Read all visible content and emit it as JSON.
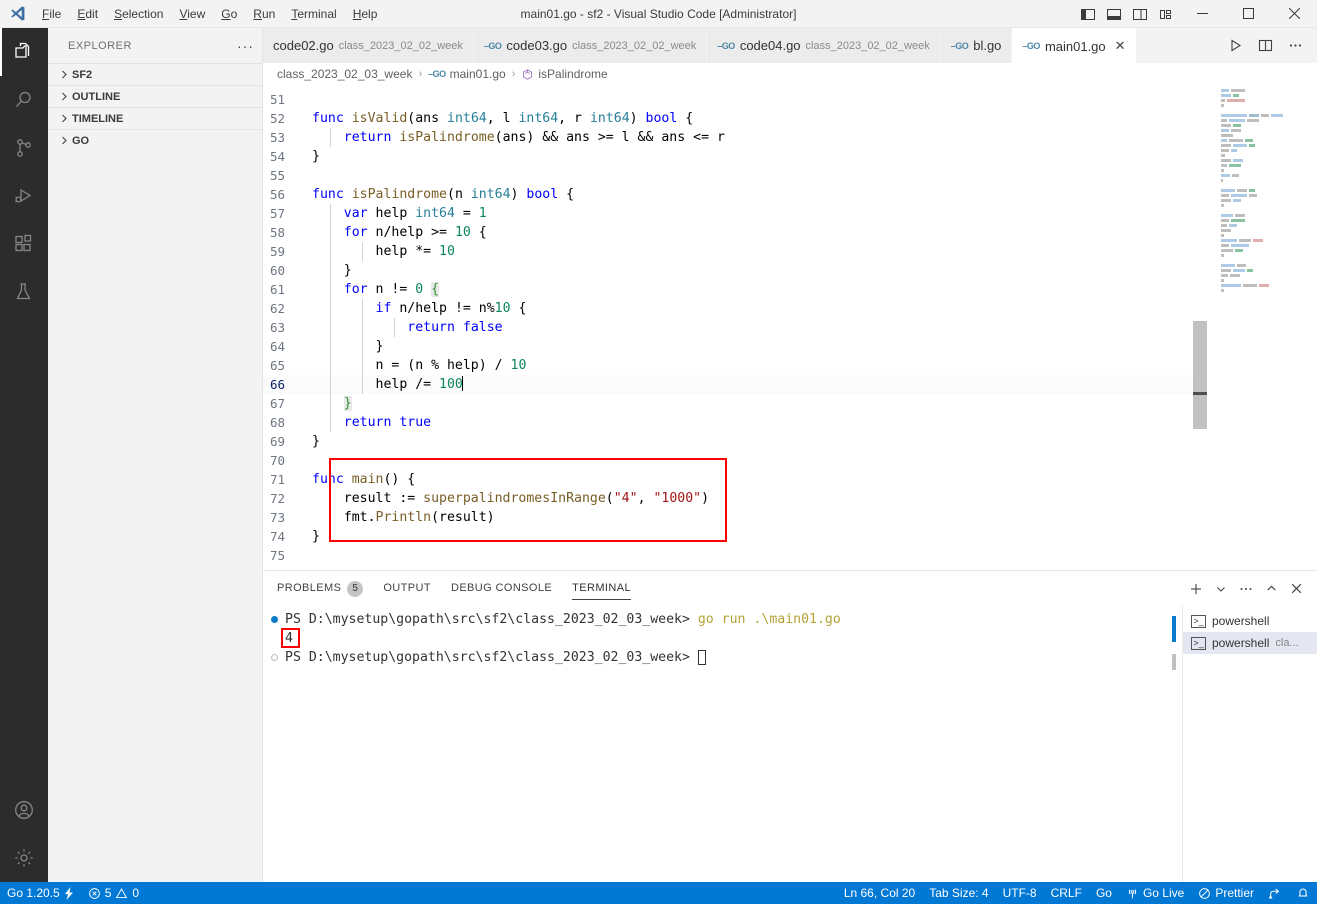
{
  "window": {
    "title": "main01.go - sf2 - Visual Studio Code [Administrator]",
    "logo": "vscode-logo",
    "layout_buttons": [
      {
        "name": "toggle-primary-sidebar",
        "label": "▯"
      },
      {
        "name": "toggle-panel",
        "label": "▯"
      },
      {
        "name": "toggle-secondary-sidebar",
        "label": "▯"
      },
      {
        "name": "customize-layout",
        "label": "▯"
      }
    ],
    "controls": {
      "minimize": "—",
      "maximize": "☐",
      "close": "✕"
    }
  },
  "menubar": [
    {
      "label": "File",
      "accel": "F"
    },
    {
      "label": "Edit",
      "accel": "E"
    },
    {
      "label": "Selection",
      "accel": "S"
    },
    {
      "label": "View",
      "accel": "V"
    },
    {
      "label": "Go",
      "accel": "G"
    },
    {
      "label": "Run",
      "accel": "R"
    },
    {
      "label": "Terminal",
      "accel": "T"
    },
    {
      "label": "Help",
      "accel": "H"
    }
  ],
  "activitybar": [
    {
      "name": "explorer",
      "icon": "files-icon",
      "active": true
    },
    {
      "name": "search",
      "icon": "search-icon",
      "active": false
    },
    {
      "name": "source-control",
      "icon": "source-control-icon",
      "active": false
    },
    {
      "name": "run-and-debug",
      "icon": "run-debug-icon",
      "active": false
    },
    {
      "name": "extensions",
      "icon": "extensions-icon",
      "active": false
    },
    {
      "name": "testing",
      "icon": "beaker-icon",
      "active": false
    },
    {
      "name": "accounts",
      "icon": "account-icon",
      "active": false
    },
    {
      "name": "settings",
      "icon": "gear-icon",
      "active": false
    }
  ],
  "sidebar": {
    "title": "EXPLORER",
    "more_actions": "···",
    "sections": [
      {
        "label": "SF2",
        "expanded": false
      },
      {
        "label": "OUTLINE",
        "expanded": false
      },
      {
        "label": "TIMELINE",
        "expanded": false
      },
      {
        "label": "GO",
        "expanded": false
      }
    ]
  },
  "tabs": [
    {
      "name": "code02.go",
      "description": "class_2023_02_02_week",
      "active": false,
      "has_go_icon": false,
      "dirty": false
    },
    {
      "name": "code03.go",
      "description": "class_2023_02_02_week",
      "active": false,
      "has_go_icon": true,
      "dirty": false
    },
    {
      "name": "code04.go",
      "description": "class_2023_02_02_week",
      "active": false,
      "has_go_icon": true,
      "dirty": false
    },
    {
      "name": "bl.go",
      "description": "",
      "active": false,
      "has_go_icon": true,
      "dirty": false
    },
    {
      "name": "main01.go",
      "description": "",
      "active": true,
      "has_go_icon": true,
      "dirty": false
    }
  ],
  "tab_actions": [
    {
      "name": "run-code-button",
      "icon": "play-icon"
    },
    {
      "name": "split-editor-button",
      "icon": "split-icon"
    },
    {
      "name": "more-actions-button",
      "icon": "ellipsis-icon"
    }
  ],
  "breadcrumbs": [
    {
      "label": "class_2023_02_03_week",
      "icon": ""
    },
    {
      "label": "main01.go",
      "icon": "go-file-icon"
    },
    {
      "label": "isPalindrome",
      "icon": "symbol-method-icon"
    }
  ],
  "editor": {
    "first_line": 51,
    "cursor_line": 66,
    "lines": [
      {
        "n": 51,
        "text": ""
      },
      {
        "n": 52,
        "text": "func isValid(ans int64, l int64, r int64) bool {"
      },
      {
        "n": 53,
        "text": "    return isPalindrome(ans) && ans >= l && ans <= r"
      },
      {
        "n": 54,
        "text": "}"
      },
      {
        "n": 55,
        "text": ""
      },
      {
        "n": 56,
        "text": "func isPalindrome(n int64) bool {"
      },
      {
        "n": 57,
        "text": "    var help int64 = 1"
      },
      {
        "n": 58,
        "text": "    for n/help >= 10 {"
      },
      {
        "n": 59,
        "text": "        help *= 10"
      },
      {
        "n": 60,
        "text": "    }"
      },
      {
        "n": 61,
        "text": "    for n != 0 {"
      },
      {
        "n": 62,
        "text": "        if n/help != n%10 {"
      },
      {
        "n": 63,
        "text": "            return false"
      },
      {
        "n": 64,
        "text": "        }"
      },
      {
        "n": 65,
        "text": "        n = (n % help) / 10"
      },
      {
        "n": 66,
        "text": "        help /= 100"
      },
      {
        "n": 67,
        "text": "    }"
      },
      {
        "n": 68,
        "text": "    return true"
      },
      {
        "n": 69,
        "text": "}"
      },
      {
        "n": 70,
        "text": ""
      },
      {
        "n": 71,
        "text": "func main() {"
      },
      {
        "n": 72,
        "text": "    result := superpalindromesInRange(\"4\", \"1000\")"
      },
      {
        "n": 73,
        "text": "    fmt.Println(result)"
      },
      {
        "n": 74,
        "text": "}"
      },
      {
        "n": 75,
        "text": ""
      }
    ],
    "annotation_color": "#ff0000",
    "annotations": [
      {
        "name": "main-function-highlight",
        "lines": "71-74"
      }
    ]
  },
  "panel": {
    "tabs": [
      {
        "label": "PROBLEMS",
        "badge": "5",
        "active": false
      },
      {
        "label": "OUTPUT",
        "badge": "",
        "active": false
      },
      {
        "label": "DEBUG CONSOLE",
        "badge": "",
        "active": false
      },
      {
        "label": "TERMINAL",
        "badge": "",
        "active": true
      }
    ],
    "actions": [
      {
        "name": "new-terminal-button",
        "icon": "plus-icon"
      },
      {
        "name": "terminal-dropdown-button",
        "icon": "chevron-down-icon"
      },
      {
        "name": "panel-more-actions-button",
        "icon": "ellipsis-icon"
      },
      {
        "name": "maximize-panel-button",
        "icon": "chevron-up-icon"
      },
      {
        "name": "close-panel-button",
        "icon": "close-icon"
      }
    ],
    "terminal": {
      "lines": [
        {
          "marker": "filled",
          "prompt": "PS D:\\mysetup\\gopath\\src\\sf2\\class_2023_02_03_week>",
          "command": " go run .\\main01.go",
          "type": "prompt"
        },
        {
          "marker": "none",
          "prompt": "",
          "command": "4",
          "type": "output",
          "highlighted": true
        },
        {
          "marker": "hollow",
          "prompt": "PS D:\\mysetup\\gopath\\src\\sf2\\class_2023_02_03_week>",
          "command": "",
          "type": "prompt",
          "cursor": true
        }
      ]
    },
    "terminal_list": [
      {
        "label": "powershell",
        "description": "",
        "active": false,
        "icon": "terminal-icon"
      },
      {
        "label": "powershell",
        "description": "cla...",
        "active": true,
        "icon": "terminal-icon"
      }
    ]
  },
  "statusbar": {
    "left": [
      {
        "name": "go-version",
        "label": "Go 1.20.5",
        "icon": "go-lightning-icon"
      },
      {
        "name": "problems-status",
        "label": "5",
        "label2": "0",
        "icon": "error-icon",
        "icon2": "warning-icon"
      }
    ],
    "right": [
      {
        "name": "editor-position",
        "label": "Ln 66, Col 20"
      },
      {
        "name": "tab-size",
        "label": "Tab Size: 4"
      },
      {
        "name": "encoding",
        "label": "UTF-8"
      },
      {
        "name": "line-endings",
        "label": "CRLF"
      },
      {
        "name": "language-mode",
        "label": "Go"
      },
      {
        "name": "go-live",
        "label": "Go Live",
        "icon": "broadcast-icon"
      },
      {
        "name": "prettier",
        "label": "Prettier",
        "icon": "prettier-icon"
      },
      {
        "name": "remote-indicator",
        "label": "",
        "icon": "remote-icon"
      },
      {
        "name": "notifications",
        "label": "",
        "icon": "bell-icon"
      }
    ]
  },
  "colors": {
    "accent": "#0078d4",
    "annotation": "#ff0000",
    "keyword": "#0000ff",
    "type": "#267f99",
    "function": "#795e26",
    "number": "#098658",
    "string": "#a31515",
    "activitybar_bg": "#2c2c2c",
    "sidebar_bg": "#f3f3f3"
  }
}
